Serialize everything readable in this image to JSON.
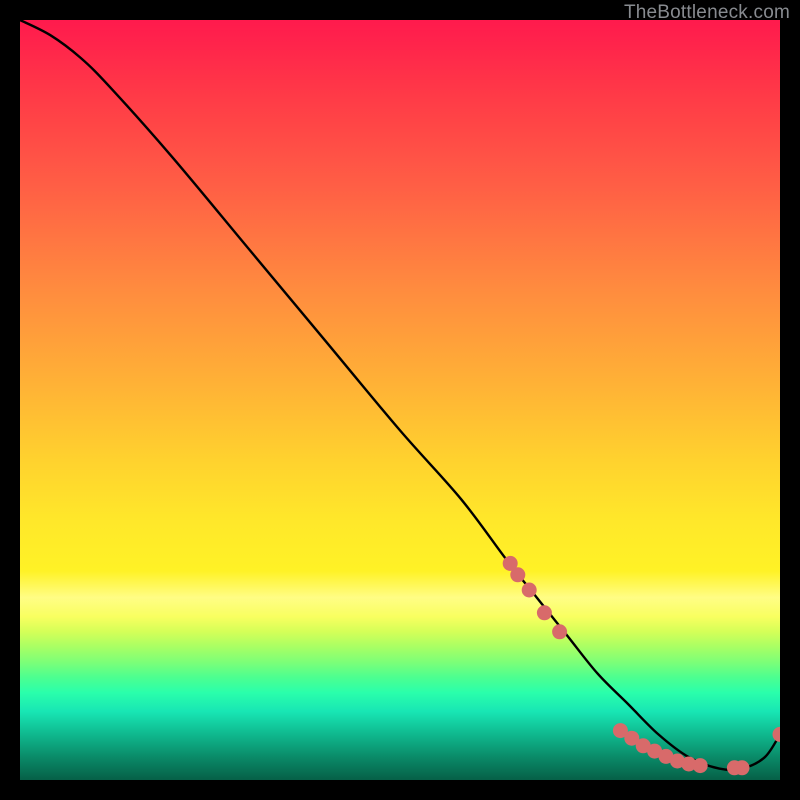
{
  "watermark": "TheBottleneck.com",
  "chart_data": {
    "type": "line",
    "title": "",
    "xlabel": "",
    "ylabel": "",
    "xlim": [
      0,
      100
    ],
    "ylim": [
      0,
      100
    ],
    "grid": false,
    "legend": false,
    "series": [
      {
        "name": "bottleneck-curve",
        "x": [
          0,
          4,
          8,
          12,
          20,
          30,
          40,
          50,
          58,
          64,
          68,
          72,
          76,
          80,
          84,
          88,
          92,
          95,
          98,
          100
        ],
        "y": [
          100,
          98,
          95,
          91,
          82,
          70,
          58,
          46,
          37,
          29,
          24,
          19,
          14,
          10,
          6,
          3,
          1.5,
          1.5,
          3,
          6
        ],
        "points_highlight_x": [
          64.5,
          65.5,
          67,
          69,
          71,
          79,
          80.5,
          82,
          83.5,
          85,
          86.5,
          88,
          89.5,
          94,
          95,
          100
        ],
        "points_highlight_y": [
          28.5,
          27,
          25,
          22,
          19.5,
          6.5,
          5.5,
          4.5,
          3.8,
          3.1,
          2.5,
          2.1,
          1.9,
          1.6,
          1.6,
          6
        ],
        "marker_color": "#d86a6a",
        "line_color": "#000000"
      }
    ]
  }
}
